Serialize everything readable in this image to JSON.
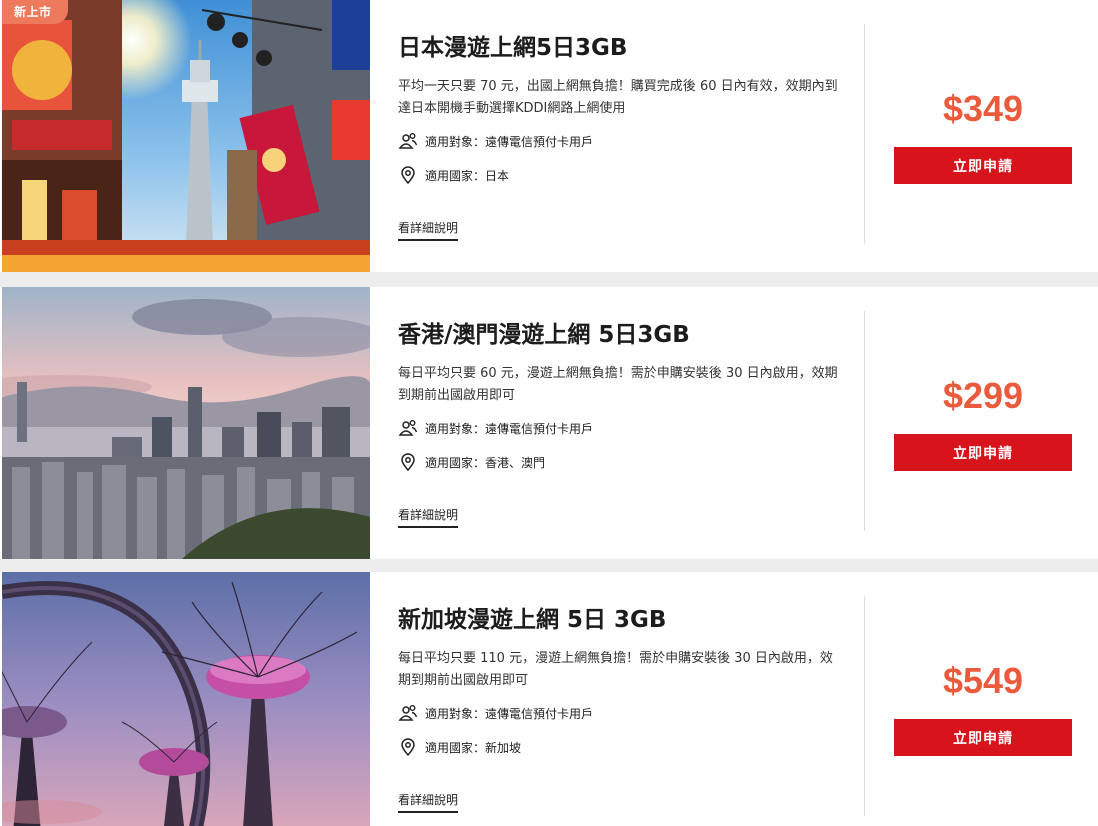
{
  "badge_new": "新上市",
  "plans": [
    {
      "title": "日本漫遊上網5日3GB",
      "desc": "平均一天只要 70 元，出國上網無負擔！購買完成後 60 日內有效，效期內到達日本開機手動選擇KDDI網路上網使用",
      "target": "適用對象：遠傳電信預付卡用戶",
      "country": "適用國家：日本",
      "detail_link": "看詳細說明",
      "price": "$349",
      "apply_label": "立即申請"
    },
    {
      "title": "香港/澳門漫遊上網 5日3GB",
      "desc": "每日平均只要 60 元，漫遊上網無負擔！需於申購安裝後 30 日內啟用，效期到期前出國啟用即可",
      "target": "適用對象：遠傳電信預付卡用戶",
      "country": "適用國家：香港、澳門",
      "detail_link": "看詳細說明",
      "price": "$299",
      "apply_label": "立即申請"
    },
    {
      "title": "新加坡漫遊上網 5日 3GB",
      "desc": "每日平均只要 110 元，漫遊上網無負擔！需於申購安裝後 30 日內啟用，效期到期前出國啟用即可",
      "target": "適用對象：遠傳電信預付卡用戶",
      "country": "適用國家：新加坡",
      "detail_link": "看詳細說明",
      "price": "$549",
      "apply_label": "立即申請"
    }
  ],
  "colors": {
    "accent_red": "#d7141c",
    "price_orange": "#ea5a3c",
    "badge_orange": "#ee7a5d"
  },
  "icons": {
    "target": "people-icon",
    "country": "location-pin-icon"
  }
}
